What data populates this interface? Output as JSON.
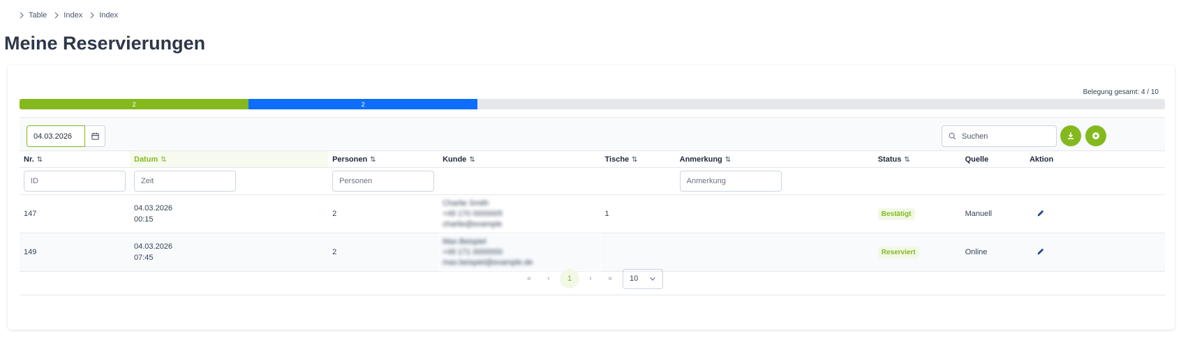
{
  "breadcrumb": [
    "Table",
    "Index",
    "Index"
  ],
  "page_title": "Meine Reservierungen",
  "occupancy": {
    "label": "Belegung gesamt: 4 / 10",
    "total": 10,
    "segments": [
      {
        "value": "2",
        "count": 2,
        "color": "#84b91e"
      },
      {
        "value": "2",
        "count": 2,
        "color": "#0d6efd"
      }
    ]
  },
  "toolbar": {
    "date_value": "04.03.2026",
    "search_placeholder": "Suchen"
  },
  "table": {
    "columns": [
      {
        "label": "Nr.",
        "sort": "⇅"
      },
      {
        "label": "Datum",
        "sort": "⇅"
      },
      {
        "label": "Personen",
        "sort": "⇅"
      },
      {
        "label": "Kunde",
        "sort": "⇅"
      },
      {
        "label": "Tische",
        "sort": "⇅"
      },
      {
        "label": "Anmerkung",
        "sort": "⇅"
      },
      {
        "label": "Status",
        "sort": "⇅"
      },
      {
        "label": "Quelle",
        "sort": ""
      },
      {
        "label": "Aktion",
        "sort": ""
      }
    ],
    "filters": {
      "id": "ID",
      "time": "Zeit",
      "persons": "Personen",
      "note": "Anmerkung"
    },
    "rows": [
      {
        "nr": "147",
        "date": "04.03.2026",
        "time": "00:15",
        "persons": "2",
        "customer": [
          "Charlie Smith",
          "+49 170 0000005",
          "charlie@example"
        ],
        "tables": "1",
        "note": "",
        "status": "Bestätigt",
        "source": "Manuell"
      },
      {
        "nr": "149",
        "date": "04.03.2026",
        "time": "07:45",
        "persons": "2",
        "customer": [
          "Max Beispiel",
          "+49 171 0000000",
          "max.beispiel@example.de"
        ],
        "tables": "",
        "note": "",
        "status": "Reserviert",
        "source": "Online"
      }
    ]
  },
  "pagination": {
    "first": "«",
    "prev": "‹",
    "current": "1",
    "next": "›",
    "last": "»",
    "per_page": "10"
  },
  "colors": {
    "accent": "#84b91e",
    "blue": "#0d6efd",
    "edit_icon": "#1e4b8f"
  },
  "icons": [
    "chevron-right-icon",
    "calendar-icon",
    "search-icon",
    "download-icon",
    "add-icon",
    "edit-icon",
    "chevron-down-icon"
  ]
}
